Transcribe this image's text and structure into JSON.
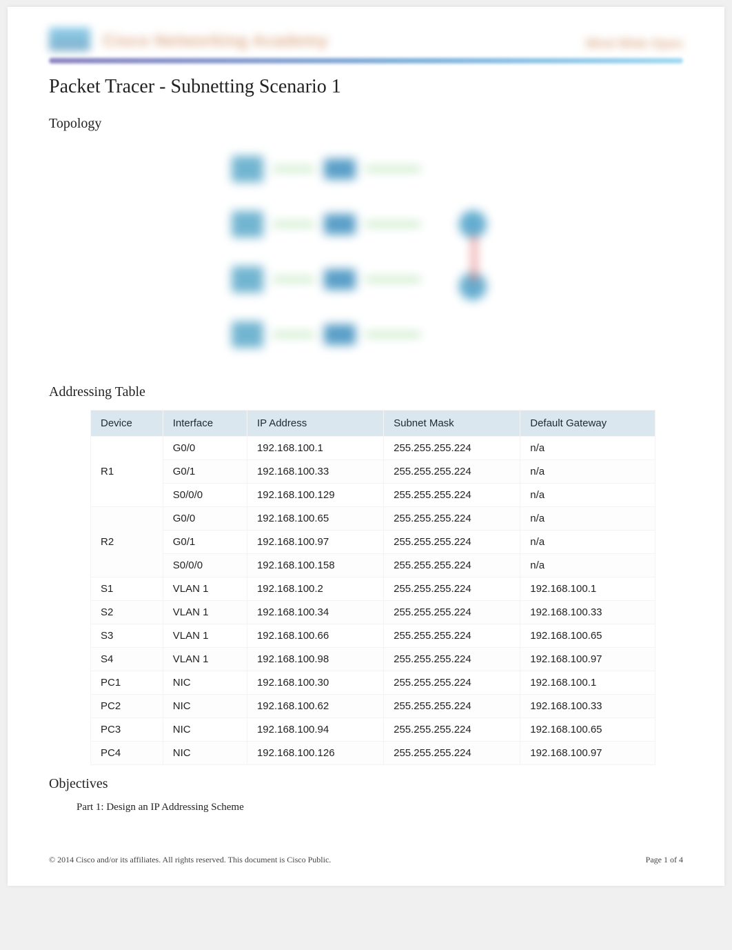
{
  "header": {
    "program_left": "Cisco Networking Academy",
    "program_right": "Mind Wide Open"
  },
  "title": "Packet Tracer - Subnetting Scenario 1",
  "sections": {
    "topology": "Topology",
    "addressing_table": "Addressing Table",
    "objectives": "Objectives"
  },
  "table": {
    "headers": {
      "device": "Device",
      "interface": "Interface",
      "ip": "IP Address",
      "mask": "Subnet Mask",
      "gw": "Default Gateway"
    },
    "rows": [
      {
        "device": "R1",
        "interface": "G0/0",
        "ip": "192.168.100.1",
        "mask": "255.255.255.224",
        "gw": "n/a",
        "span": 3
      },
      {
        "device": "",
        "interface": "G0/1",
        "ip": "192.168.100.33",
        "mask": "255.255.255.224",
        "gw": "n/a",
        "span": 0
      },
      {
        "device": "",
        "interface": "S0/0/0",
        "ip": "192.168.100.129",
        "mask": "255.255.255.224",
        "gw": "n/a",
        "span": 0
      },
      {
        "device": "R2",
        "interface": "G0/0",
        "ip": "192.168.100.65",
        "mask": "255.255.255.224",
        "gw": "n/a",
        "span": 3
      },
      {
        "device": "",
        "interface": "G0/1",
        "ip": "192.168.100.97",
        "mask": "255.255.255.224",
        "gw": "n/a",
        "span": 0
      },
      {
        "device": "",
        "interface": "S0/0/0",
        "ip": "192.168.100.158",
        "mask": "255.255.255.224",
        "gw": "n/a",
        "span": 0
      },
      {
        "device": "S1",
        "interface": "VLAN 1",
        "ip": "192.168.100.2",
        "mask": "255.255.255.224",
        "gw": "192.168.100.1",
        "span": 1
      },
      {
        "device": "S2",
        "interface": "VLAN 1",
        "ip": "192.168.100.34",
        "mask": "255.255.255.224",
        "gw": "192.168.100.33",
        "span": 1
      },
      {
        "device": "S3",
        "interface": "VLAN 1",
        "ip": "192.168.100.66",
        "mask": "255.255.255.224",
        "gw": "192.168.100.65",
        "span": 1
      },
      {
        "device": "S4",
        "interface": "VLAN 1",
        "ip": "192.168.100.98",
        "mask": "255.255.255.224",
        "gw": "192.168.100.97",
        "span": 1
      },
      {
        "device": "PC1",
        "interface": "NIC",
        "ip": "192.168.100.30",
        "mask": "255.255.255.224",
        "gw": "192.168.100.1",
        "span": 1
      },
      {
        "device": "PC2",
        "interface": "NIC",
        "ip": "192.168.100.62",
        "mask": "255.255.255.224",
        "gw": "192.168.100.33",
        "span": 1
      },
      {
        "device": "PC3",
        "interface": "NIC",
        "ip": "192.168.100.94",
        "mask": "255.255.255.224",
        "gw": "192.168.100.65",
        "span": 1
      },
      {
        "device": "PC4",
        "interface": "NIC",
        "ip": "192.168.100.126",
        "mask": "255.255.255.224",
        "gw": "192.168.100.97",
        "span": 1
      }
    ]
  },
  "objectives": {
    "part1": "Part 1: Design an IP Addressing Scheme"
  },
  "footer": {
    "copyright": "© 2014 Cisco and/or its affiliates. All rights reserved. This document is Cisco Public.",
    "page": "Page  1  of 4"
  }
}
